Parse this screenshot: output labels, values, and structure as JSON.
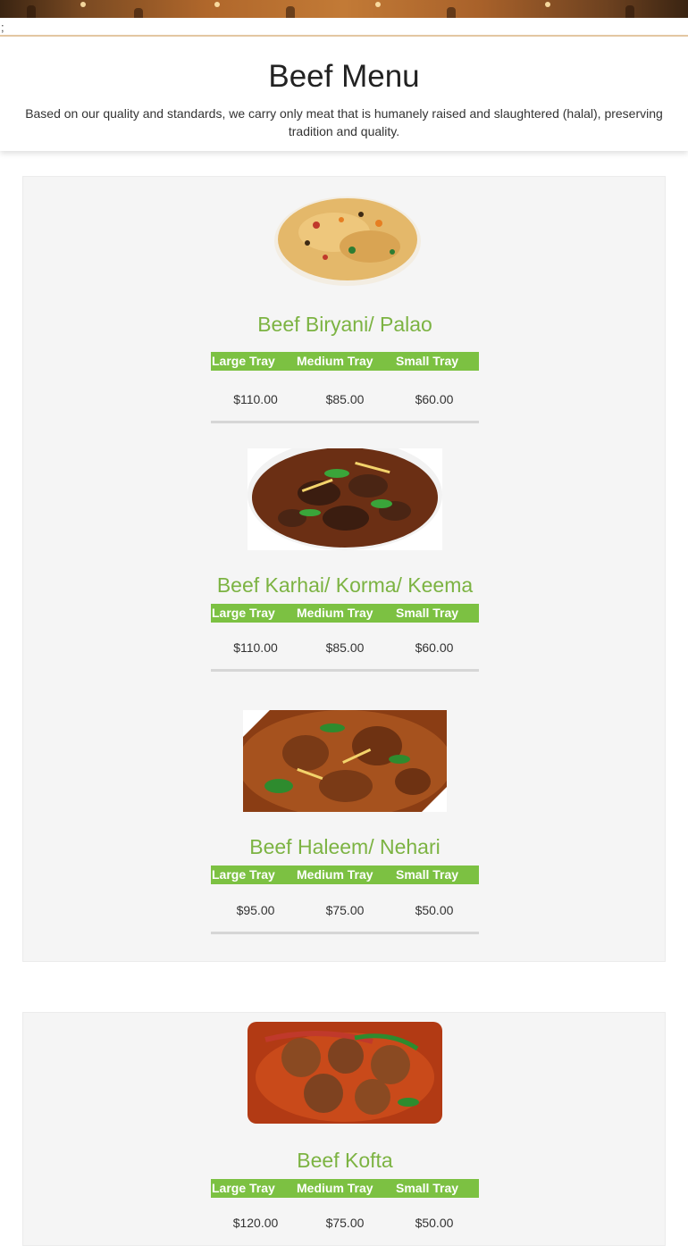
{
  "header": {
    "semicolon": ";"
  },
  "intro": {
    "title": "Beef Menu",
    "description": "Based on our quality and standards, we carry only meat that is humanely raised and slaughtered (halal), preserving tradition and quality."
  },
  "colors": {
    "accent_green": "#7cc142",
    "title_green": "#7cb342",
    "panel_bg": "#f5f5f5"
  },
  "tray_labels": {
    "large": "Large Tray",
    "medium": "Medium Tray",
    "small": "Small Tray"
  },
  "dishes": [
    {
      "name": "Beef Biryani/ Palao",
      "image_icon": "biryani-plate-image",
      "large": "$110.00",
      "medium": "$85.00",
      "small": "$60.00"
    },
    {
      "name": "Beef Karhai/ Korma/ Keema",
      "image_icon": "karhai-bowl-image",
      "large": "$110.00",
      "medium": "$85.00",
      "small": "$60.00"
    },
    {
      "name": "Beef Haleem/ Nehari",
      "image_icon": "nehari-curry-image",
      "large": "$95.00",
      "medium": "$75.00",
      "small": "$50.00"
    },
    {
      "name": "Beef Kofta",
      "image_icon": "kofta-curry-image",
      "large": "$120.00",
      "medium": "$75.00",
      "small": "$50.00"
    }
  ]
}
